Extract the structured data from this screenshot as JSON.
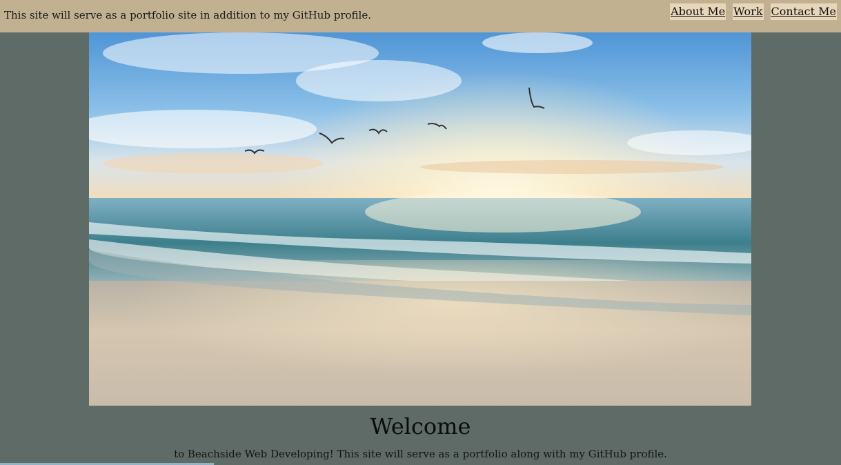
{
  "header": {
    "tagline": "This site will serve as a portfolio site in addition to my GitHub profile.",
    "nav": [
      {
        "label": "About Me",
        "icon": ""
      },
      {
        "label": "Work"
      },
      {
        "label": "Contact Me"
      }
    ]
  },
  "hero": {
    "image_alt": "beach-sunset-with-seagulls"
  },
  "welcome": {
    "title": "Welcome",
    "subtitle": "to Beachside Web Developing! This site will serve as a portfolio along with my GitHub profile."
  },
  "colors": {
    "background": "#5e6b66",
    "header": "#c2b191",
    "nav_button": "#e7d6b9"
  }
}
